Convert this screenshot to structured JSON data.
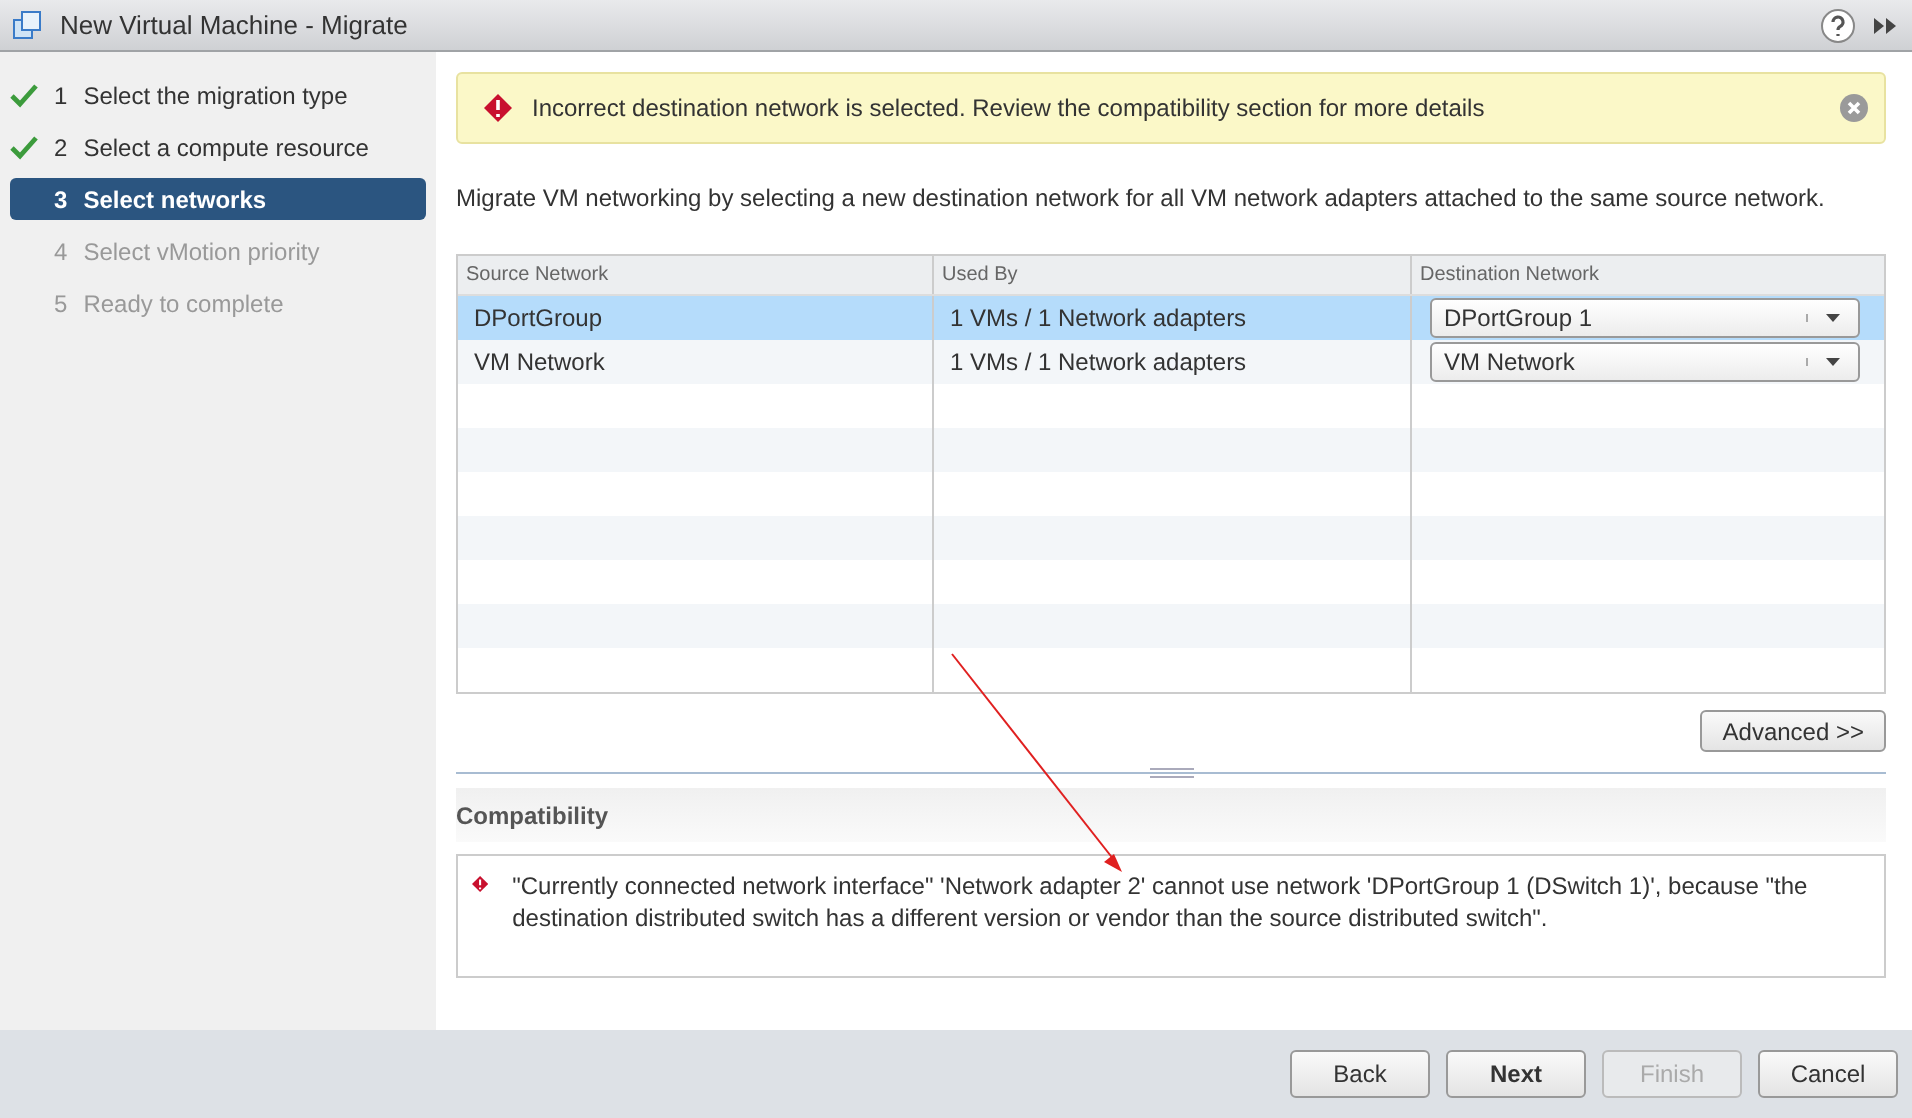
{
  "window": {
    "title": "New Virtual Machine - Migrate"
  },
  "steps": [
    {
      "number": "1",
      "label": "Select the migration type",
      "done": true,
      "selected": false,
      "disabled": false
    },
    {
      "number": "2",
      "label": "Select a compute resource",
      "done": true,
      "selected": false,
      "disabled": false
    },
    {
      "number": "3",
      "label": "Select networks",
      "done": false,
      "selected": true,
      "disabled": false
    },
    {
      "number": "4",
      "label": "Select vMotion priority",
      "done": false,
      "selected": false,
      "disabled": true
    },
    {
      "number": "5",
      "label": "Ready to complete",
      "done": false,
      "selected": false,
      "disabled": true
    }
  ],
  "banner": {
    "message": "Incorrect destination network is selected. Review the compatibility section for more details"
  },
  "description": "Migrate VM networking by selecting a new destination network for all VM network adapters attached to the same source network.",
  "table": {
    "columns": [
      "Source Network",
      "Used By",
      "Destination Network"
    ],
    "rows": [
      {
        "source": "DPortGroup",
        "used_by": "1 VMs / 1 Network adapters",
        "destination": "DPortGroup 1",
        "selected": true
      },
      {
        "source": "VM Network",
        "used_by": "1 VMs / 1 Network adapters",
        "destination": "VM Network",
        "selected": false
      }
    ]
  },
  "advanced_button": "Advanced >>",
  "compatibility": {
    "title": "Compatibility",
    "message": "\"Currently connected network interface\" 'Network adapter 2' cannot use network 'DPortGroup 1 (DSwitch 1)', because \"the destination distributed switch has a different version or vendor than the source distributed switch\"."
  },
  "buttons": [
    {
      "label": "Back",
      "kind": "normal",
      "disabled": false
    },
    {
      "label": "Next",
      "kind": "primary",
      "disabled": false
    },
    {
      "label": "Finish",
      "kind": "normal",
      "disabled": true
    },
    {
      "label": "Cancel",
      "kind": "normal",
      "disabled": false
    }
  ]
}
